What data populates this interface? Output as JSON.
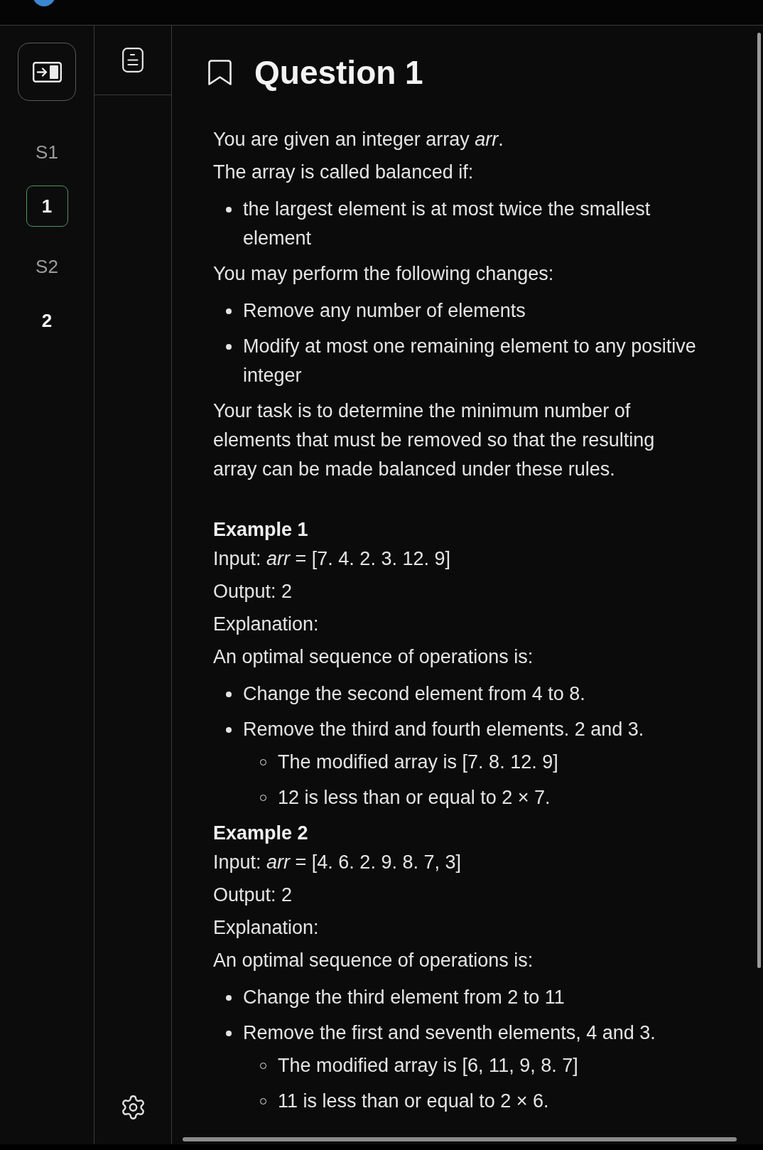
{
  "rail": {
    "sections": [
      {
        "label": "S1",
        "questions": [
          {
            "label": "1",
            "selected": true
          }
        ]
      },
      {
        "label": "S2",
        "questions": [
          {
            "label": "2",
            "selected": false
          }
        ]
      }
    ]
  },
  "question": {
    "title": "Question 1",
    "bookmarked": false,
    "blocks": [
      {
        "kind": "paragraph",
        "text": "You are given an integer array *arr*."
      },
      {
        "kind": "paragraph",
        "text": "The array is called balanced if:"
      },
      {
        "kind": "list",
        "items": [
          {
            "text": "the largest element is at most twice the smallest element"
          }
        ]
      },
      {
        "kind": "paragraph",
        "text": "You may perform the following changes:"
      },
      {
        "kind": "list",
        "items": [
          {
            "text": "Remove any number of elements"
          },
          {
            "text": "Modify at most one remaining element to any positive integer"
          }
        ]
      },
      {
        "kind": "paragraph",
        "text": "Your task is to determine the minimum number of elements that must be removed so that the resulting array can be made balanced under these rules."
      },
      {
        "kind": "heading",
        "text": "Example 1"
      },
      {
        "kind": "paragraph",
        "text": "Input: *arr* = [7. 4. 2. 3. 12. 9]"
      },
      {
        "kind": "paragraph",
        "text": "Output: 2"
      },
      {
        "kind": "paragraph",
        "text": "Explanation:"
      },
      {
        "kind": "paragraph",
        "text": "An optimal sequence of operations is:"
      },
      {
        "kind": "list",
        "items": [
          {
            "text": "Change the second element from 4 to 8."
          },
          {
            "text": "Remove the third and fourth elements. 2 and 3.",
            "children": [
              {
                "text": "The modified array is [7. 8. 12. 9]"
              },
              {
                "text": "12 is less than or equal to 2 × 7."
              }
            ]
          }
        ]
      },
      {
        "kind": "heading",
        "text": "Example 2"
      },
      {
        "kind": "paragraph",
        "text": "Input: *arr* = [4. 6. 2. 9. 8. 7, 3]"
      },
      {
        "kind": "paragraph",
        "text": "Output: 2"
      },
      {
        "kind": "paragraph",
        "text": "Explanation:"
      },
      {
        "kind": "paragraph",
        "text": "An optimal sequence of operations is:"
      },
      {
        "kind": "list",
        "items": [
          {
            "text": "Change the third element from 2 to 11"
          },
          {
            "text": "Remove the first and seventh elements, 4 and 3.",
            "children": [
              {
                "text": "The modified array is [6, 11, 9, 8. 7]"
              },
              {
                "text": "11 is less than or equal to 2 × 6."
              }
            ]
          }
        ]
      }
    ]
  }
}
